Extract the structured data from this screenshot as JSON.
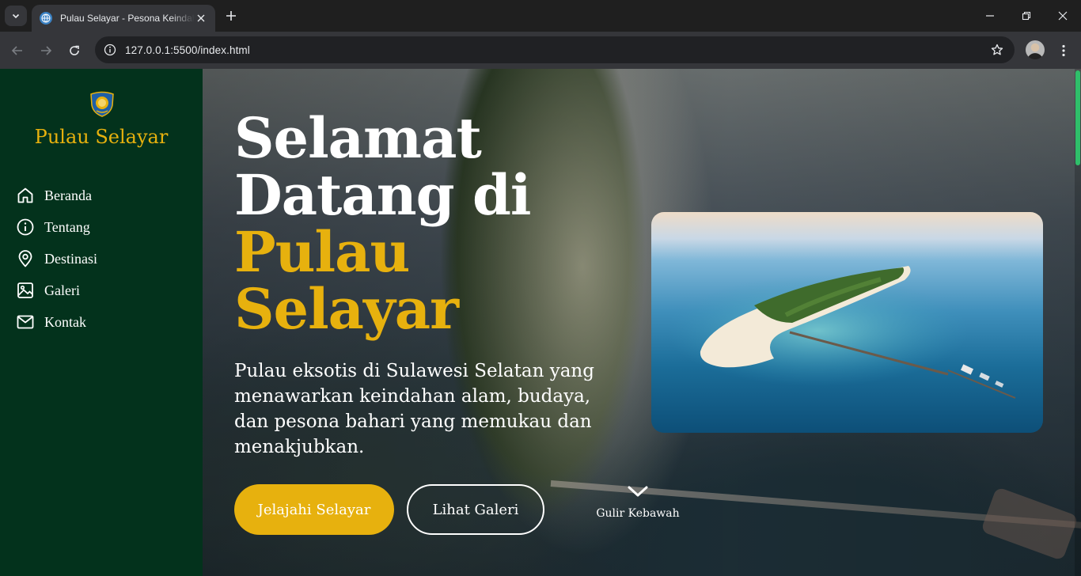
{
  "browser": {
    "tab_title": "Pulau Selayar - Pesona Keindahan Selayar",
    "url": "127.0.0.1:5500/index.html"
  },
  "sidebar": {
    "brand": "Pulau Selayar",
    "logo_icon": "regency-emblem-icon",
    "items": [
      {
        "label": "Beranda",
        "icon": "home-icon"
      },
      {
        "label": "Tentang",
        "icon": "info-icon"
      },
      {
        "label": "Destinasi",
        "icon": "map-pin-icon"
      },
      {
        "label": "Galeri",
        "icon": "image-icon"
      },
      {
        "label": "Kontak",
        "icon": "mail-icon"
      }
    ]
  },
  "hero": {
    "title_line1": "Selamat",
    "title_line2": "Datang di",
    "title_line3": "Pulau",
    "title_line4": "Selayar",
    "description": "Pulau eksotis di Sulawesi Selatan yang menawarkan keindahan alam, budaya, dan pesona bahari yang memukau dan menakjubkan.",
    "primary_button": "Jelajahi Selayar",
    "secondary_button": "Lihat Galeri",
    "scroll_label": "Gulir Kebawah"
  },
  "colors": {
    "sidebar_bg": "#03321c",
    "accent_gold": "#e7b10e",
    "text_white": "#ffffff"
  }
}
